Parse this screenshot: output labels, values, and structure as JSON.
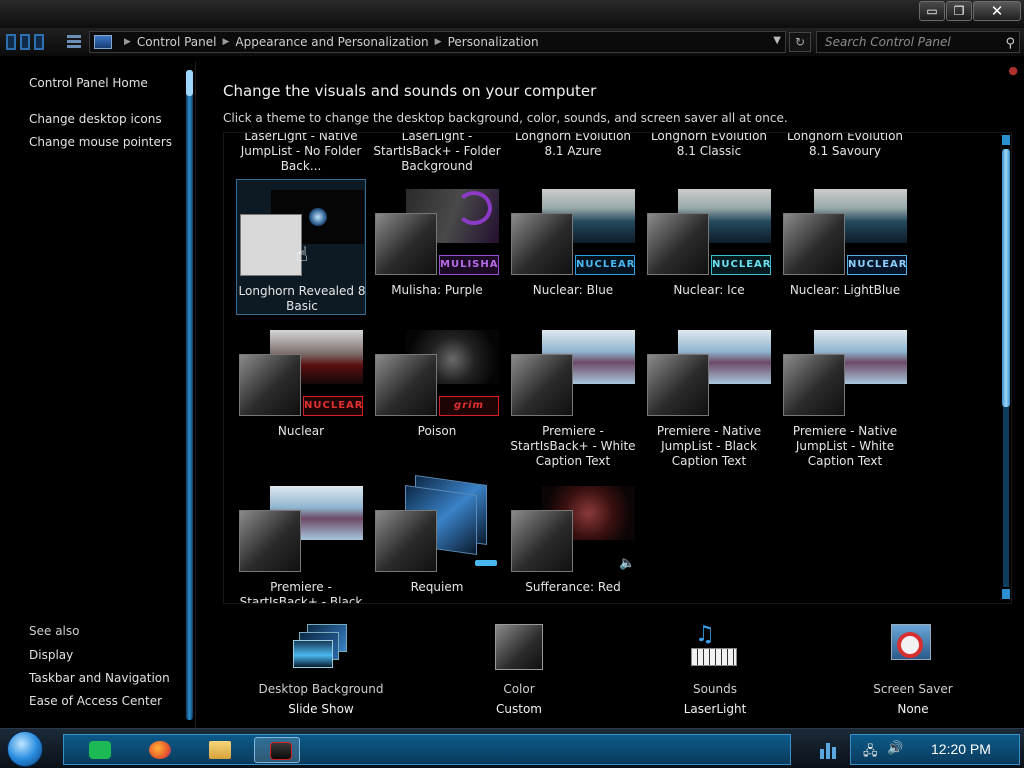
{
  "window": {
    "min_glyph": "▭",
    "max_glyph": "❐",
    "close_glyph": "✕"
  },
  "address": {
    "crumbs": [
      "Control Panel",
      "Appearance and Personalization",
      "Personalization"
    ],
    "search_placeholder": "Search Control Panel"
  },
  "sidebar": {
    "home": "Control Panel Home",
    "tasks": [
      "Change desktop icons",
      "Change mouse pointers"
    ],
    "see_also_title": "See also",
    "see_also": [
      "Display",
      "Taskbar and Navigation",
      "Ease of Access Center"
    ]
  },
  "main": {
    "title": "Change the visuals and sounds on your computer",
    "subtitle": "Click a theme to change the desktop background, color, sounds, and screen saver all at once."
  },
  "themes": {
    "top_row": [
      "LaserLight - Native JumpList - No Folder Back...",
      "LaserLight - StartIsBack+ - Folder Background",
      "Longhorn Evolution 8.1 Azure",
      "Longhorn Evolution 8.1 Classic",
      "Longhorn Evolution 8.1 Savoury"
    ],
    "row1": [
      "Longhorn Revealed 8 Basic",
      "Mulisha: Purple",
      "Nuclear: Blue",
      "Nuclear: Ice",
      "Nuclear: LightBlue"
    ],
    "row2": [
      "Nuclear",
      "Poison",
      "Premiere - StartIsBack+ - White Caption Text",
      "Premiere - Native JumpList - Black Caption Text",
      "Premiere - Native JumpList - White Caption Text"
    ],
    "row3": [
      "Premiere - StartIsBack+ - Black",
      "Requiem",
      "Sufferance: Red"
    ],
    "badges": {
      "mulisha": "MULISHA",
      "nuclear": "NUCLEAR",
      "grim": "grim"
    }
  },
  "bottom": {
    "background_label": "Desktop Background",
    "background_value": "Slide Show",
    "color_label": "Color",
    "color_value": "Custom",
    "sounds_label": "Sounds",
    "sounds_value": "LaserLight",
    "saver_label": "Screen Saver",
    "saver_value": "None"
  },
  "taskbar": {
    "clock": "12:20 PM"
  },
  "colors": {
    "accent": "#2a8ed0",
    "selection_border": "#3a6d95",
    "nuclear_badge": "#2a9fe0",
    "mulisha_badge": "#9b4ad6",
    "red_badge": "#d02020"
  }
}
